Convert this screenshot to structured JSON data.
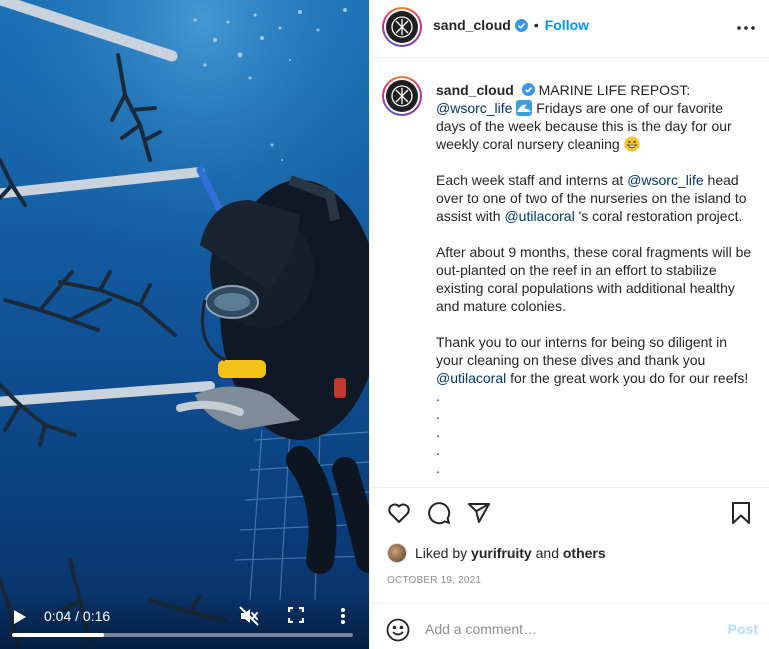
{
  "video": {
    "current_time": "0:04",
    "duration": "0:16",
    "time_separator": " / ",
    "progress_fraction": 0.27,
    "icons": {
      "play": "play-icon",
      "mute": "muted-speaker-icon",
      "fullscreen": "fullscreen-icon",
      "more": "vertical-dots-icon"
    }
  },
  "header": {
    "username": "sand_cloud",
    "separator": "•",
    "follow_label": "Follow",
    "icons": {
      "verified": "verified-badge-icon",
      "more": "horizontal-dots-icon"
    }
  },
  "caption": {
    "username": "sand_cloud",
    "p1_text": "MARINE LIFE REPOST: ",
    "p1_mention": "@wsorc_life",
    "p1_rest": " Fridays are one of our favorite days of the week because this is the day for our weekly coral nursery cleaning ",
    "p2_a": "Each week staff and interns at ",
    "p2_mention1": "@wsorc_life",
    "p2_b": " head over to one of two of the nurseries on the island to assist with ",
    "p2_mention2": "@utilacoral",
    "p2_c": " 's coral restoration project.",
    "p3": "After about 9 months, these coral fragments will be out-planted on the reef in an effort to stabilize existing coral populations with additional healthy and mature colonies.",
    "p4_a": "Thank you to our interns for being so diligent in your cleaning on these dives and thank you ",
    "p4_mention": "@utilacoral",
    "p4_b": " for the great work you do for our reefs!",
    "dots": [
      ".",
      ".",
      ".",
      ".",
      "."
    ],
    "emojis": [
      "wave-emoji",
      "grinning-face-emoji"
    ]
  },
  "actions": {
    "icons": [
      "heart-icon",
      "comment-icon",
      "share-icon",
      "bookmark-icon"
    ]
  },
  "likes": {
    "prefix": "Liked by ",
    "user": "yurifruity",
    "middle": " and ",
    "others": "others"
  },
  "date": "OCTOBER 19, 2021",
  "comment": {
    "placeholder": "Add a comment…",
    "post_label": "Post"
  },
  "colors": {
    "link_blue": "#0095f6",
    "mention_blue": "#00376b",
    "text": "#262626",
    "muted": "#8e8e8e",
    "disabled_post": "#b2dffc",
    "water_top": "#1c70b4",
    "water_bottom": "#082f63"
  }
}
